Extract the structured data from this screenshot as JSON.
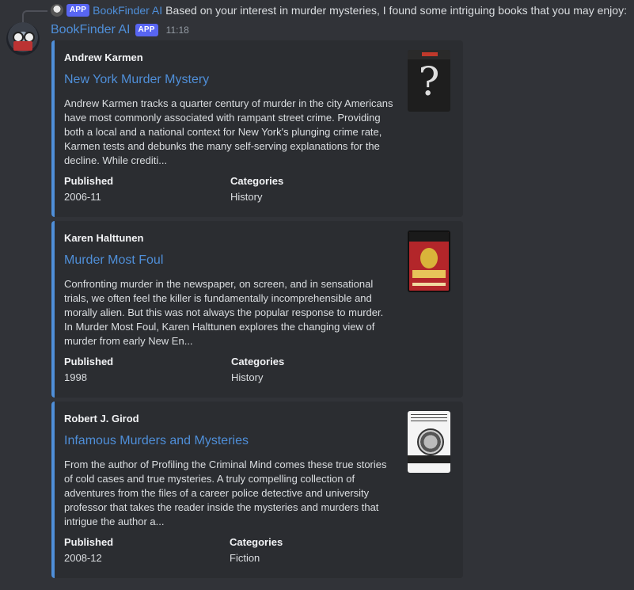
{
  "reply": {
    "badge": "APP",
    "author": "BookFinder AI",
    "text": "Based on your interest in murder mysteries, I found some intriguing books that you may enjoy: •..."
  },
  "message": {
    "author": "BookFinder AI",
    "badge": "APP",
    "time": "11:18"
  },
  "embeds": [
    {
      "author": "Andrew Karmen",
      "title": "New York Murder Mystery",
      "description": "Andrew Karmen tracks a quarter century of murder in the city Americans have most commonly associated with rampant street crime. Providing both a local and a national context for New York's plunging crime rate, Karmen tests and debunks the many self-serving explanations for the decline. While crediti...",
      "fields": [
        {
          "name": "Published",
          "value": "2006-11"
        },
        {
          "name": "Categories",
          "value": "History"
        }
      ]
    },
    {
      "author": "Karen Halttunen",
      "title": "Murder Most Foul",
      "description": "Confronting murder in the newspaper, on screen, and in sensational trials, we often feel the killer is fundamentally incomprehensible and morally alien. But this was not always the popular response to murder. In Murder Most Foul, Karen Halttunen explores the changing view of murder from early New En...",
      "fields": [
        {
          "name": "Published",
          "value": "1998"
        },
        {
          "name": "Categories",
          "value": "History"
        }
      ]
    },
    {
      "author": "Robert J. Girod",
      "title": "Infamous Murders and Mysteries",
      "description": "From the author of Profiling the Criminal Mind comes these true stories of cold cases and true mysteries. A truly compelling collection of adventures from the files of a career police detective and university professor that takes the reader inside the mysteries and murders that intrigue the author a...",
      "fields": [
        {
          "name": "Published",
          "value": "2008-12"
        },
        {
          "name": "Categories",
          "value": "Fiction"
        }
      ]
    }
  ],
  "colors": {
    "background": "#313338",
    "embed_bg": "#2b2d31",
    "accent": "#4f8fd9",
    "badge": "#5865f2"
  }
}
